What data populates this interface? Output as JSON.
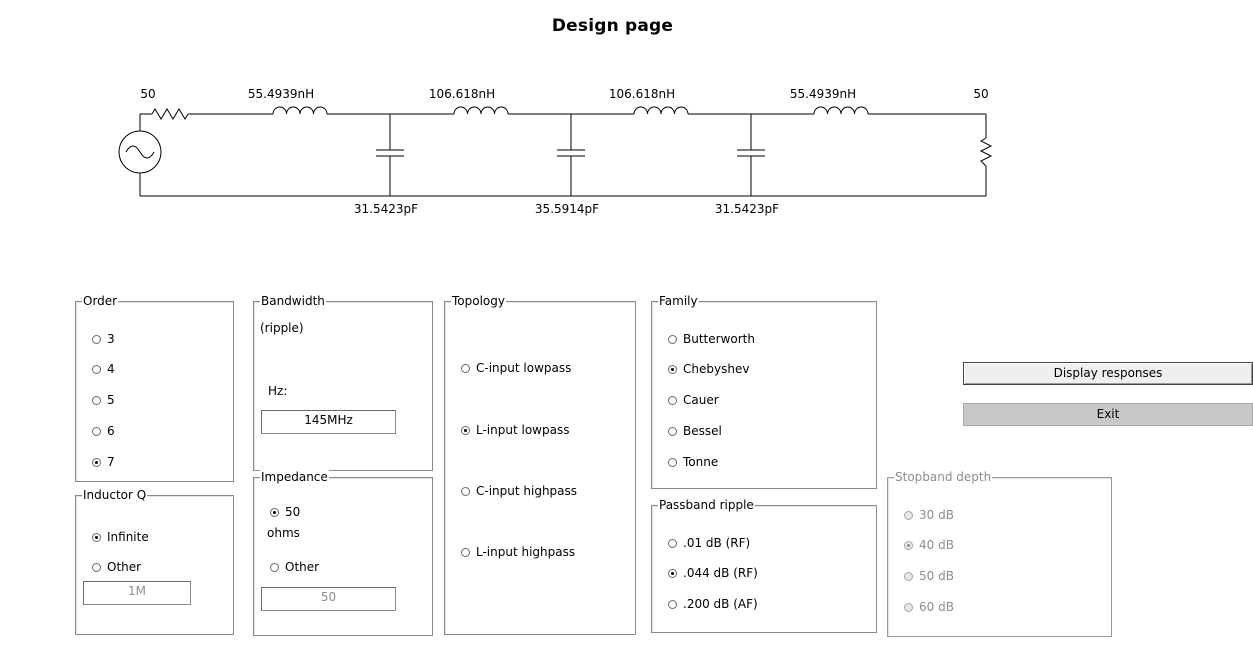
{
  "page_title": "Design page",
  "schematic": {
    "source_impedance": "50",
    "load_impedance": "50",
    "inductors": [
      "55.4939nH",
      "106.618nH",
      "106.618nH",
      "55.4939nH"
    ],
    "capacitors": [
      "31.5423pF",
      "35.5914pF",
      "31.5423pF"
    ]
  },
  "order": {
    "label": "Order",
    "options": [
      "3",
      "4",
      "5",
      "6",
      "7"
    ],
    "selected": "7"
  },
  "inductor_q": {
    "label": "Inductor Q",
    "options": [
      "Infinite",
      "Other"
    ],
    "selected": "Infinite",
    "other_value": "1M"
  },
  "bandwidth": {
    "label": "Bandwidth",
    "sub_label": "(ripple)",
    "unit_label": "Hz:",
    "value": "145MHz"
  },
  "impedance": {
    "label": "Impedance",
    "option_50": "50",
    "ohms_label": "ohms",
    "option_other": "Other",
    "other_value": "50",
    "selected": "50"
  },
  "topology": {
    "label": "Topology",
    "options": [
      "C-input lowpass",
      "L-input lowpass",
      "C-input highpass",
      "L-input highpass"
    ],
    "selected": "L-input lowpass"
  },
  "family": {
    "label": "Family",
    "options": [
      "Butterworth",
      "Chebyshev",
      "Cauer",
      "Bessel",
      "Tonne"
    ],
    "selected": "Chebyshev"
  },
  "passband_ripple": {
    "label": "Passband ripple",
    "options": [
      ".01 dB (RF)",
      ".044 dB (RF)",
      ".200 dB (AF)"
    ],
    "selected": ".044 dB (RF)"
  },
  "stopband_depth": {
    "label": "Stopband depth",
    "options": [
      "30 dB",
      "40 dB",
      "50 dB",
      "60 dB"
    ],
    "selected": "40 dB",
    "enabled": false
  },
  "buttons": {
    "display_responses": "Display responses",
    "exit": "Exit"
  }
}
